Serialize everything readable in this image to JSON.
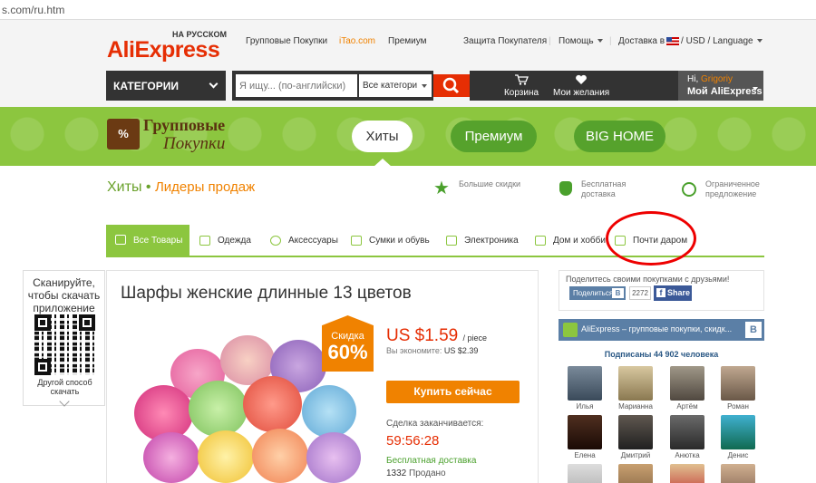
{
  "browser": {
    "url": "s.com/ru.htm"
  },
  "header": {
    "logo_lang": "НА РУССКОМ",
    "logo_text": "AliExpress",
    "nav": [
      "Групповые Покупки",
      "iTao.com",
      "Премиум"
    ],
    "protection": "Защита Покупателя",
    "help": "Помощь",
    "delivery": "Доставка в",
    "currency": "USD",
    "language": "Language",
    "categories": "КАТЕГОРИИ",
    "search_placeholder": "Я ищу... (по-английски)",
    "search_category": "Все категори",
    "cart": "Корзина",
    "wishlist": "Мои желания",
    "user_hi": "Hi,",
    "user_name": "Grigoriy",
    "my_aliexpress": "Мой AliExpress"
  },
  "banner": {
    "logo_line1": "Групповые",
    "logo_line2": "Покупки",
    "tabs": [
      "Хиты",
      "Премиум",
      "BIG HOME"
    ]
  },
  "subheader": {
    "title": "Хиты",
    "leaders": "Лидеры продаж",
    "features": [
      {
        "text": "Большие скидки",
        "icon": "star-icon"
      },
      {
        "text": "Бесплатная доставка",
        "icon": "money-bag-icon"
      },
      {
        "text": "Ограниченное предложение",
        "icon": "clock-icon"
      }
    ]
  },
  "categories": [
    "Все Товары",
    "Одежда",
    "Аксессуары",
    "Сумки и обувь",
    "Электроника",
    "Дом и хобби",
    "Почти даром"
  ],
  "qr": {
    "title": "Сканируйте, чтобы скачать приложение",
    "alt": "Другой способ скачать"
  },
  "product": {
    "title": "Шарфы женские длинные 13 цветов",
    "badge_label": "Скидка",
    "badge_value": "60%",
    "price": "US $1.59",
    "per": "/ piece",
    "save_label": "Вы экономите:",
    "save_value": "US $2.39",
    "buy_label": "Купить сейчас",
    "ends_label": "Сделка заканчивается:",
    "timer": "59:56:28",
    "shipping": "Бесплатная доставка",
    "sold_count": "1332",
    "sold_label": "Продано"
  },
  "social": {
    "share_text": "Поделитесь своими покупками с друзьями!",
    "vk_share": "Поделиться",
    "vk_count": "2272",
    "fb_share": "Share",
    "group_title": "AliExpress – групповые покупки, скидк...",
    "subscribers": "Подписаны 44 902 человека",
    "members": [
      "Илья",
      "Марианна",
      "Артём",
      "Роман",
      "Елена",
      "Дмитрий",
      "Анютка",
      "Денис"
    ]
  },
  "colors": {
    "green": "#8cc63f",
    "orange": "#f08200",
    "red": "#e62e04",
    "vk": "#5b7fa6"
  }
}
